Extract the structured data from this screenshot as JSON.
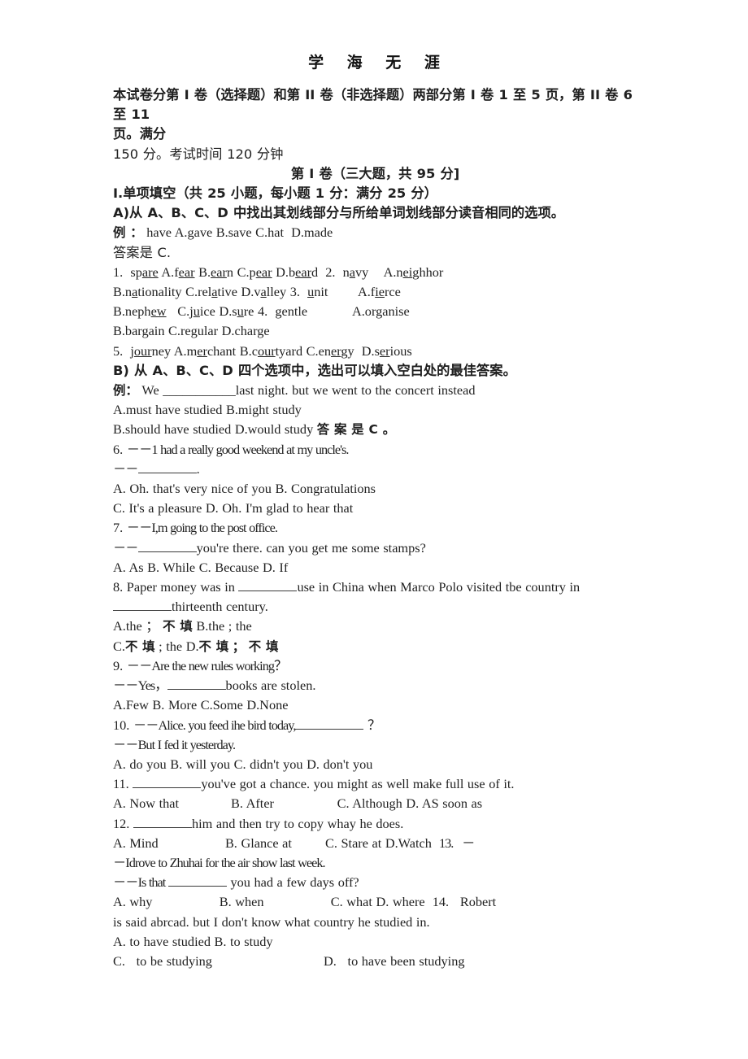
{
  "document": {
    "header_title": "学 海 无 涯",
    "paper_width": 920,
    "paper_height": 1302,
    "ink_color": "#1f1f1f"
  },
  "intro": {
    "line1": "本试卷分第 I 卷（选择题）和第 II 卷（非选择题）两部分第 I 卷 1 至 5 页，第 II 卷 6 至 11",
    "line2": "页。满分",
    "line3": "150 分。考试时间 120 分钟",
    "section_heading": "第 I 卷（三大题，共 95 分]"
  },
  "section_one": {
    "title": "I.单项填空（共 25 小题，每小题 1 分：满分 25 分）",
    "part_a_instruction": "A)从 A、B、C、D 中找出其划线部分与所给单词划线部分读音相同的选项。",
    "example_label": "例 ：",
    "example_text": "have A.gave B.save C.hat  D.made",
    "example_answer": "答案是 C.",
    "part_b_instruction": "B) 从 A、B、C、D 四个选项中，选出可以填入空白处的最佳答案。",
    "b_example_label": "例：",
    "b_example_text": "We ___________last night. but we went to the concert instead",
    "b_example_optA": "A.must have studied B.might study",
    "b_example_optB": "B.should have studied D.would study",
    "b_example_answer": "答 案 是 C 。"
  },
  "phonetics": {
    "q1": {
      "number": "1.",
      "stem_pre": "sp",
      "stem_underline": "are",
      "stem_post": "",
      "options": [
        {
          "label": "A.f",
          "under": "ear",
          "post": ""
        },
        {
          "label": "B.",
          "under": "ear",
          "post": "n"
        },
        {
          "label": "C.p",
          "under": "ear",
          "post": ""
        },
        {
          "label": "D.b",
          "under": "ear",
          "post": "d"
        }
      ]
    },
    "q2": {
      "number": "2.",
      "stem_pre": "n",
      "stem_underline": "a",
      "stem_post": "vy",
      "options": [
        {
          "label": "A.n",
          "under": "ei",
          "post": "ghhor"
        },
        {
          "label": "B.n",
          "under": "a",
          "post": "tionality"
        },
        {
          "label": "C.rel",
          "under": "a",
          "post": "tive"
        },
        {
          "label": "D.v",
          "under": "a",
          "post": "lley"
        }
      ]
    },
    "q3": {
      "number": "3.",
      "stem_pre": "",
      "stem_underline": "u",
      "stem_post": "nit",
      "options": [
        {
          "label": "A.f",
          "under": "ie",
          "post": "rce"
        },
        {
          "label": "B.neph",
          "under": "ew",
          "post": ""
        },
        {
          "label": "C.j",
          "under": "u",
          "post": "ice"
        },
        {
          "label": "D.s",
          "under": "u",
          "post": "re"
        }
      ]
    },
    "q4": {
      "number": "4.",
      "stem_pre": "",
      "stem_underline": "g",
      "stem_post": "entle",
      "options": [
        {
          "label": "A.or",
          "under": "g",
          "post": "anise"
        },
        {
          "label": "B.bar",
          "under": "g",
          "post": "ain"
        },
        {
          "label": "C.re",
          "under": "g",
          "post": "ular"
        },
        {
          "label": "D.char",
          "under": "g",
          "post": "e"
        }
      ]
    },
    "q5": {
      "number": "5.",
      "stem_pre": "j",
      "stem_underline": "our",
      "stem_post": "ney",
      "options": [
        {
          "label": "A.m",
          "under": "er",
          "post": "chant"
        },
        {
          "label": "B.c",
          "under": "our",
          "post": "tyard"
        },
        {
          "label": "C.en",
          "under": "er",
          "post": "gy"
        },
        {
          "label": "D.s",
          "under": "er",
          "post": "ious"
        }
      ]
    }
  },
  "questions": {
    "q6": {
      "number": "6.",
      "prompt": "－－1 had a really good weekend at my uncle's.",
      "reply_dash": "－－",
      "reply_tail": ".",
      "optionsA": "A. Oh. that's very nice of you B. Congratulations",
      "optionsB": "C. It's a pleasure D. Oh. I'm glad to hear that"
    },
    "q7": {
      "number": "7.",
      "prompt": "－－I,m going to the post office.",
      "reply_dash": "－－",
      "reply_tail": "you're there. can you get me some stamps?",
      "options": "A. As B. While C. Because D. If"
    },
    "q8": {
      "number": "8.",
      "stem_pre": "Paper money was in ",
      "stem_post": "use in China when Marco Polo visited tbe country in",
      "stem_line2_post": "thirteenth century.",
      "optionsA": "A.the ；",
      "optionsA_cn": "不 填",
      "optionsA_tail": "B.the ; the",
      "optionsB_pre": "C.",
      "optionsB_cn1": "不 填",
      "optionsB_mid": "; the D.",
      "optionsB_cn2": "不 填",
      "optionsB_mid2": "；",
      "optionsB_cn3": "不 填"
    },
    "q9": {
      "number": "9.",
      "prompt": "－－Are the new rules working？",
      "reply_pre": "－－Yes，",
      "reply_post": "books are stolen.",
      "options": "A.Few B. More C.Some D.None"
    },
    "q10": {
      "number": "10.",
      "prompt_pre": "－－Alice. you feed ihe bird today,",
      "prompt_post": " ？",
      "reply": "－－But I fed it yesterday.",
      "options": "A. do you B. will you C. didn't you D. don't you"
    },
    "q11": {
      "number": "11.",
      "stem_post": "you've got a chance. you might as well make full use of it.",
      "options": "A. Now that              B. After                 C. Although D. AS soon as"
    },
    "q12": {
      "number": "12.",
      "stem_post": "him and then try to copy whay he does.",
      "options": "A. Mind                  B. Glance at         C. Stare at D.Watch",
      "options_tail": "13.   －"
    },
    "q13": {
      "prompt": "－Idrove to Zhuhai for the air show last week.",
      "reply_pre": "－－Is that ",
      "reply_post": " you had a few days off?",
      "options": "A. why                  B. when                  C. what D. where",
      "options_tail": "14.   Robert"
    },
    "q14": {
      "stem": "is said abrcad. but I don't know what country he studied in.",
      "optionsA": "A. to have studied B. to study",
      "optionsC": "C.   to be studying",
      "optionsD": "D.   to have been studying"
    }
  }
}
